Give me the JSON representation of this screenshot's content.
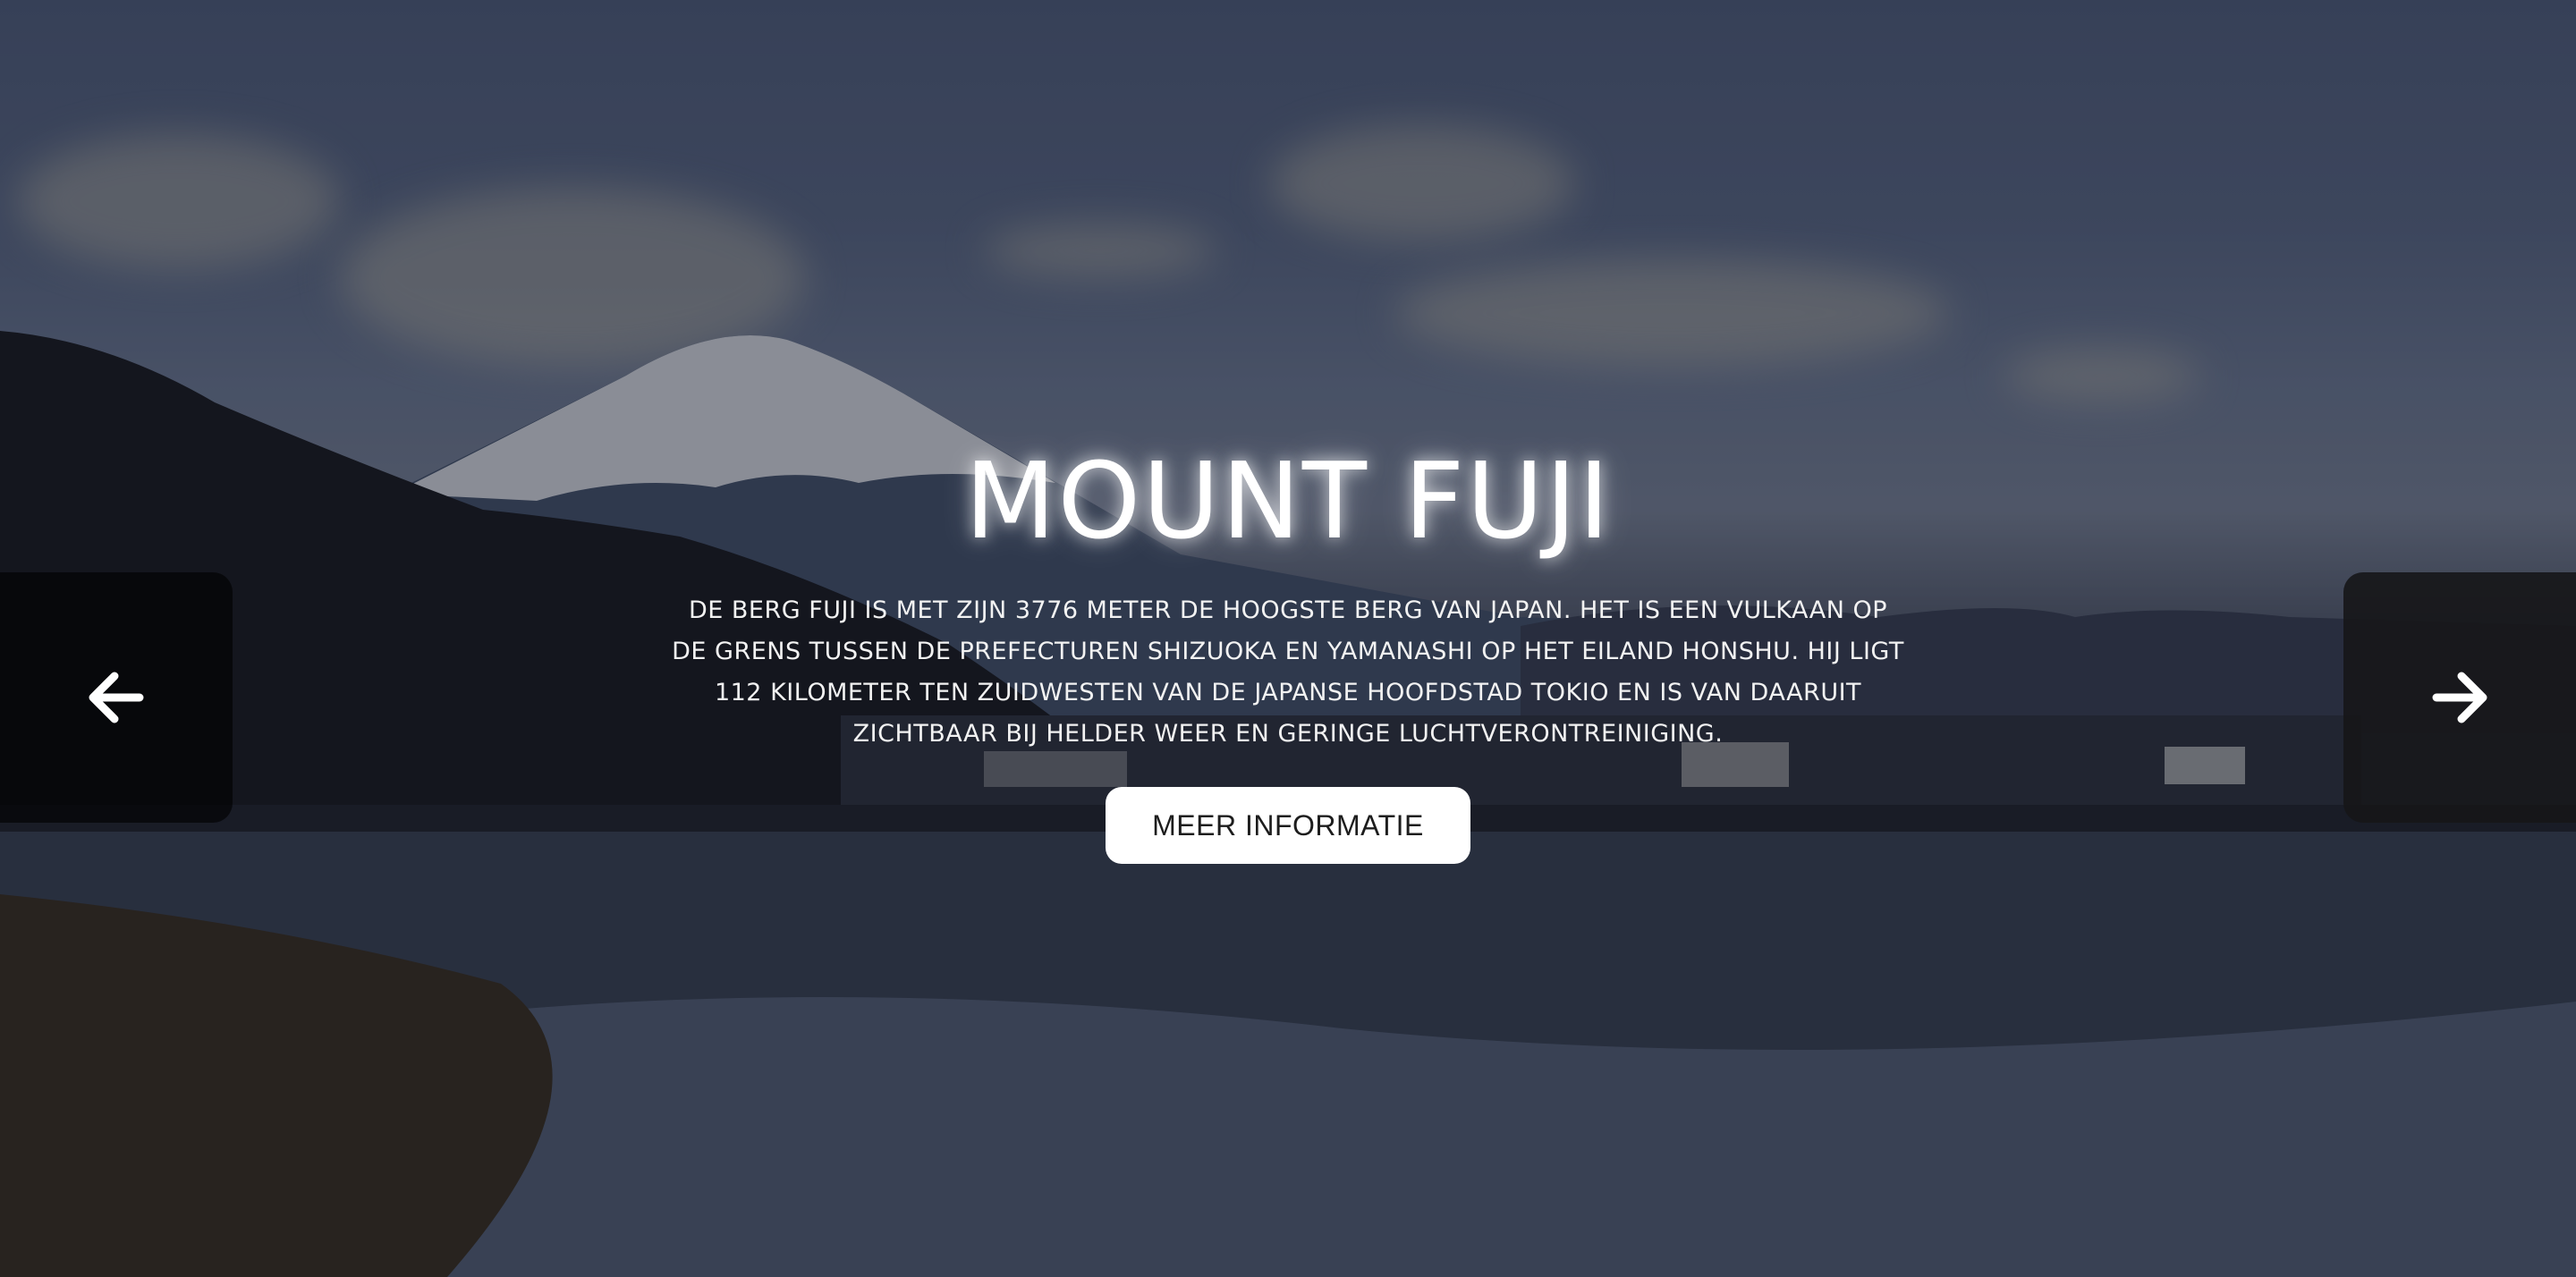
{
  "hero": {
    "title": "MOUNT FUJI",
    "description": "DE BERG FUJI IS MET ZIJN 3776 METER DE HOOGSTE BERG VAN JAPAN. HET IS EEN VULKAAN OP DE GRENS TUSSEN DE PREFECTUREN SHIZUOKA EN YAMANASHI OP HET EILAND HONSHU. HIJ LIGT 112 KILOMETER TEN ZUIDWESTEN VAN DE JAPANSE HOOFDSTAD TOKIO EN IS VAN DAARUIT ZICHTBAAR BIJ HELDER WEER EN GERINGE LUCHTVERONTREINIGING.",
    "cta_label": "MEER INFORMATIE"
  },
  "navigation": {
    "prev_icon": "arrow-left-icon",
    "next_icon": "arrow-right-icon"
  },
  "colors": {
    "text": "#ffffff",
    "button_bg": "#ffffff",
    "button_text": "#1d1d1d"
  }
}
